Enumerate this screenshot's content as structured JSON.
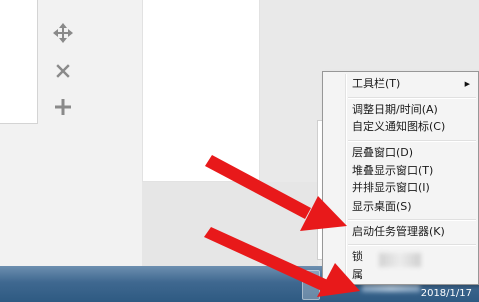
{
  "context_menu": {
    "items": [
      {
        "label": "工具栏(T)",
        "has_submenu": true
      },
      {
        "label": "调整日期/时间(A)"
      },
      {
        "label": "自定义通知图标(C)"
      },
      {
        "label": "层叠窗口(D)"
      },
      {
        "label": "堆叠显示窗口(T)"
      },
      {
        "label": "并排显示窗口(I)"
      },
      {
        "label": "显示桌面(S)"
      },
      {
        "label": "启动任务管理器(K)"
      },
      {
        "label": "锁"
      },
      {
        "label": "属"
      }
    ]
  },
  "taskbar": {
    "clock_text": "2018/1/17"
  },
  "icons": {
    "move": "move-icon",
    "close": "close-icon",
    "add": "plus-icon",
    "submenu": "chevron-right-icon"
  },
  "colors": {
    "annotation_arrow": "#e8191a",
    "taskbar": "#3f6890",
    "menu_background": "#f4f4f4"
  }
}
